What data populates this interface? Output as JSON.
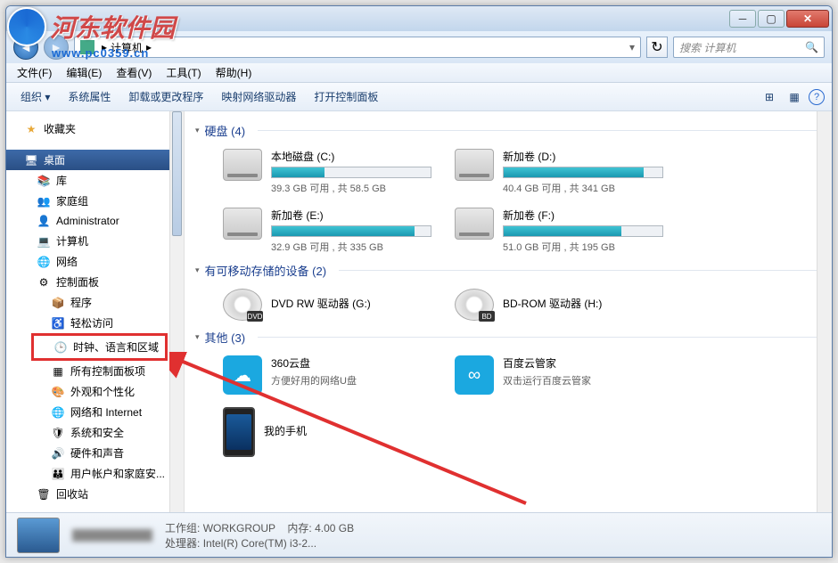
{
  "watermark": {
    "text": "河东软件园",
    "url": "www.pc0359.cn"
  },
  "window": {
    "buttons": {
      "min": "─",
      "max": "▢",
      "close": "✕"
    }
  },
  "addressbar": {
    "back_tip": "返回",
    "fwd_tip": "前进",
    "path_sep1": "▸",
    "path_label": "计算机",
    "path_sep2": "▸",
    "refresh": "↻",
    "search_placeholder": "搜索 计算机"
  },
  "menubar": {
    "file": "文件(F)",
    "edit": "编辑(E)",
    "view": "查看(V)",
    "tools": "工具(T)",
    "help": "帮助(H)"
  },
  "toolbar": {
    "organize": "组织 ▾",
    "props": "系统属性",
    "uninstall": "卸载或更改程序",
    "mapnet": "映射网络驱动器",
    "cpanel": "打开控制面板",
    "view_icon": "⊞",
    "preview_icon": "▦",
    "help_icon": "?"
  },
  "sidebar": {
    "favorites": "收藏夹",
    "desktop": "桌面",
    "libraries": "库",
    "homegroup": "家庭组",
    "admin": "Administrator",
    "computer": "计算机",
    "network": "网络",
    "cpanel": "控制面板",
    "cp_programs": "程序",
    "cp_ease": "轻松访问",
    "cp_clock": "时钟、语言和区域",
    "cp_allitems": "所有控制面板项",
    "cp_appearance": "外观和个性化",
    "cp_netinet": "网络和 Internet",
    "cp_security": "系统和安全",
    "cp_hardware": "硬件和声音",
    "cp_users": "用户帐户和家庭安...",
    "recycle": "回收站"
  },
  "groups": {
    "hdd": {
      "label": "硬盘 (4)"
    },
    "removable": {
      "label": "有可移动存储的设备 (2)"
    },
    "other": {
      "label": "其他 (3)"
    }
  },
  "drives": {
    "c": {
      "name": "本地磁盘 (C:)",
      "sub": "39.3 GB 可用 , 共 58.5 GB",
      "pct": 33
    },
    "d": {
      "name": "新加卷 (D:)",
      "sub": "40.4 GB 可用 , 共 341 GB",
      "pct": 88
    },
    "e": {
      "name": "新加卷 (E:)",
      "sub": "32.9 GB 可用 , 共 335 GB",
      "pct": 90
    },
    "f": {
      "name": "新加卷 (F:)",
      "sub": "51.0 GB 可用 , 共 195 GB",
      "pct": 74
    }
  },
  "removable": {
    "dvd": {
      "name": "DVD RW 驱动器 (G:)",
      "badge": "DVD"
    },
    "bd": {
      "name": "BD-ROM 驱动器 (H:)",
      "badge": "BD"
    }
  },
  "other": {
    "cloud360": {
      "name": "360云盘",
      "sub": "方便好用的网络U盘"
    },
    "baidu": {
      "name": "百度云管家",
      "sub": "双击运行百度云管家"
    },
    "phone": {
      "name": "我的手机"
    }
  },
  "statusbar": {
    "workgroup_label": "工作组:",
    "workgroup_val": "WORKGROUP",
    "mem_label": "内存:",
    "mem_val": "4.00 GB",
    "cpu_label": "处理器:",
    "cpu_val": "Intel(R) Core(TM) i3-2..."
  }
}
